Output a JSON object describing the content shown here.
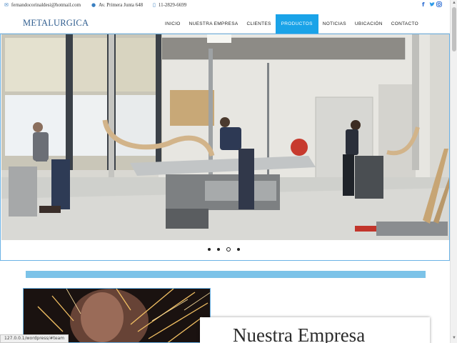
{
  "topbar": {
    "email": "fernandocorinaldesi@hotmail.com",
    "address": "Av. Primera Junta 648",
    "phone": "11-2829-6699",
    "social": [
      "f",
      "t",
      "i"
    ]
  },
  "nav": {
    "logo": "METALURGICA",
    "items": [
      {
        "label": "INICIO",
        "active": false
      },
      {
        "label": "NUESTRA EMPRESA",
        "active": false
      },
      {
        "label": "CLIENTES",
        "active": false
      },
      {
        "label": "PRODUCTOS",
        "active": true
      },
      {
        "label": "NOTICIAS",
        "active": false
      },
      {
        "label": "UBICACIÓN",
        "active": false
      },
      {
        "label": "CONTACTO",
        "active": false
      }
    ]
  },
  "slider": {
    "slide_count": 4,
    "active_index": 2
  },
  "about": {
    "title": "Nuestra Empresa"
  },
  "status": {
    "url": "127.0.0.1/wordpress/#team"
  },
  "colors": {
    "accent": "#1aa3e8",
    "logo": "#2f5d8f",
    "bar": "#7cc3e8",
    "border": "#6cb3e6"
  }
}
